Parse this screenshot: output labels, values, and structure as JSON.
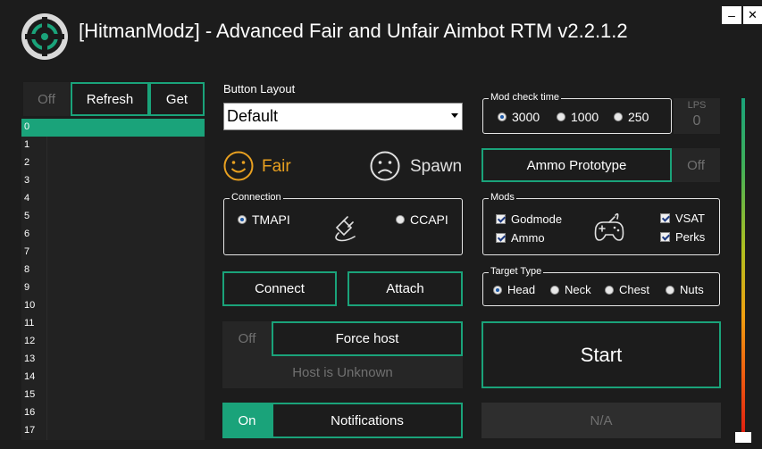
{
  "window": {
    "title": "[HitmanModz] - Advanced Fair and Unfair Aimbot RTM v2.2.1.2",
    "minimize_label": "–",
    "close_label": "✕"
  },
  "left": {
    "off_label": "Off",
    "refresh_label": "Refresh",
    "get_label": "Get",
    "rows": [
      "0",
      "1",
      "2",
      "3",
      "4",
      "5",
      "6",
      "7",
      "8",
      "9",
      "10",
      "11",
      "12",
      "13",
      "14",
      "15",
      "16",
      "17"
    ]
  },
  "layout": {
    "label": "Button Layout",
    "selected": "Default"
  },
  "modes": {
    "fair_label": "Fair",
    "spawn_label": "Spawn"
  },
  "connection": {
    "legend": "Connection",
    "tmapi_label": "TMAPI",
    "ccapi_label": "CCAPI",
    "connect_label": "Connect",
    "attach_label": "Attach"
  },
  "forcehost": {
    "off_label": "Off",
    "button_label": "Force host",
    "status": "Host is Unknown"
  },
  "notifications": {
    "on_label": "On",
    "button_label": "Notifications"
  },
  "modcheck": {
    "legend": "Mod check time",
    "opt1": "3000",
    "opt2": "1000",
    "opt3": "250",
    "lps_label": "LPS",
    "lps_value": "0"
  },
  "ammo": {
    "button_label": "Ammo Prototype",
    "off_label": "Off"
  },
  "mods": {
    "legend": "Mods",
    "godmode": "Godmode",
    "ammo": "Ammo",
    "vsat": "VSAT",
    "perks": "Perks"
  },
  "target": {
    "legend": "Target Type",
    "head": "Head",
    "neck": "Neck",
    "chest": "Chest",
    "nuts": "Nuts"
  },
  "start_label": "Start",
  "na_label": "N/A",
  "colors": {
    "accent": "#1aa37a",
    "fair": "#e8a020",
    "background": "#1c1c1c"
  }
}
